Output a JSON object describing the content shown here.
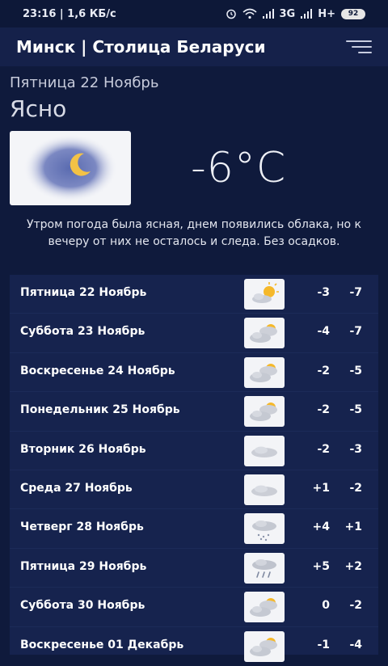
{
  "status_bar": {
    "time_speed": "23:16 | 1,6 КБ/с",
    "network": "3G",
    "network2": "H+",
    "battery": "92",
    "icons": [
      "alarm-icon",
      "wifi-icon",
      "signal-icon",
      "signal-icon",
      "battery-icon"
    ]
  },
  "app_bar": {
    "title": "Минск | Столица Беларуси",
    "menu_icon": "menu-icon"
  },
  "today": {
    "date": "Пятница 22 Ноябрь",
    "condition": "Ясно",
    "icon": "clear-night-icon",
    "temperature": "-6°C",
    "description": "Утром погода была ясная, днем появились облака, но к вечеру от них не осталось и следа. Без осадков."
  },
  "forecast": [
    {
      "day": "Пятница 22 Ноябрь",
      "icon": "partly-sunny-icon",
      "max": "-3",
      "min": "-7"
    },
    {
      "day": "Суббота 23 Ноябрь",
      "icon": "cloudy-sun-icon",
      "max": "-4",
      "min": "-7"
    },
    {
      "day": "Воскресенье 24 Ноябрь",
      "icon": "cloudy-sun-icon",
      "max": "-2",
      "min": "-5"
    },
    {
      "day": "Понедельник 25 Ноябрь",
      "icon": "cloudy-sun-icon",
      "max": "-2",
      "min": "-5"
    },
    {
      "day": "Вторник 26 Ноябрь",
      "icon": "cloud-icon",
      "max": "-2",
      "min": "-3"
    },
    {
      "day": "Среда 27 Ноябрь",
      "icon": "cloud-icon",
      "max": "+1",
      "min": "-2"
    },
    {
      "day": "Четверг 28 Ноябрь",
      "icon": "rain-cloud-icon",
      "max": "+4",
      "min": "+1"
    },
    {
      "day": "Пятница 29 Ноябрь",
      "icon": "rain-cloud-icon",
      "max": "+5",
      "min": "+2"
    },
    {
      "day": "Суббота 30 Ноябрь",
      "icon": "cloudy-sun-icon",
      "max": "0",
      "min": "-2"
    },
    {
      "day": "Воскресенье 01 Декабрь",
      "icon": "cloudy-sun-icon",
      "max": "-1",
      "min": "-4"
    }
  ]
}
